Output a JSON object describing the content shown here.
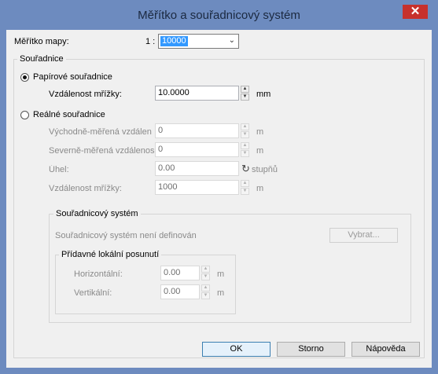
{
  "dialog": {
    "title": "Měřítko a souřadnicový systém",
    "close_symbol": "✕"
  },
  "scale": {
    "label": "Měřítko mapy:",
    "prefix": "1 :",
    "value": "10000"
  },
  "coords": {
    "group_title": "Souřadnice",
    "paper": {
      "label": "Papírové souřadnice",
      "selected": true,
      "grid_label": "Vzdálenost mřížky:",
      "grid_value": "10.0000",
      "grid_unit": "mm"
    },
    "real": {
      "label": "Reálné souřadnice",
      "selected": false,
      "east_label": "Východně-měřená vzdálen",
      "east_value": "0",
      "east_unit": "m",
      "north_label": "Severně-měřená vzdálenos",
      "north_value": "0",
      "north_unit": "m",
      "angle_label": "Úhel:",
      "angle_value": "0.00",
      "angle_unit": "stupňů",
      "grid_label": "Vzdálenost mřížky:",
      "grid_value": "1000",
      "grid_unit": "m"
    }
  },
  "coord_system": {
    "group_title": "Souřadnicový systém",
    "status_text": "Souřadnicový systém není definován",
    "select_button": "Vybrat...",
    "local_shift": {
      "group_title": "Přídavné lokální posunutí",
      "horizontal_label": "Horizontální:",
      "horizontal_value": "0.00",
      "horizontal_unit": "m",
      "vertical_label": "Vertikální:",
      "vertical_value": "0.00",
      "vertical_unit": "m"
    }
  },
  "buttons": {
    "ok": "OK",
    "cancel": "Storno",
    "help": "Nápověda"
  },
  "icons": {
    "spin_up": "▲",
    "spin_down": "▼",
    "dropdown": "⌄",
    "rotate": "↻"
  }
}
